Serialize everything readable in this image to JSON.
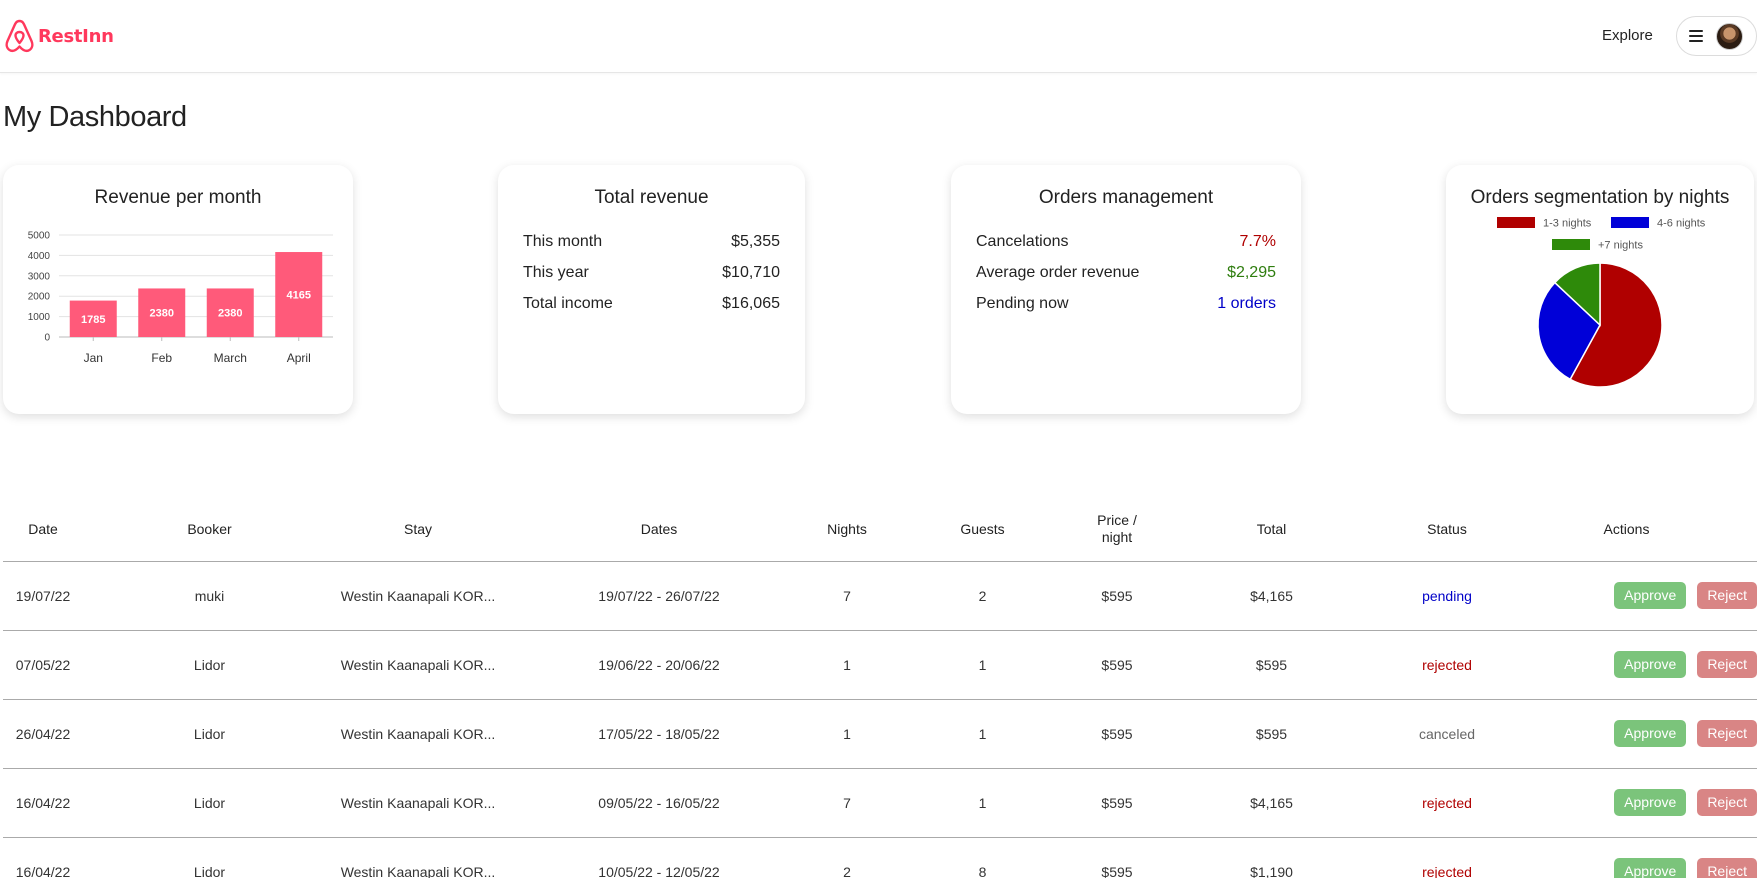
{
  "header": {
    "brand": "RestInn",
    "explore_label": "Explore",
    "icons": {
      "logo": "logo-icon",
      "menu": "menu-icon",
      "avatar": "avatar"
    }
  },
  "page": {
    "title": "My Dashboard"
  },
  "cards": {
    "revenue_chart": {
      "title": "Revenue per month"
    },
    "total_revenue": {
      "title": "Total revenue",
      "rows": [
        {
          "label": "This month",
          "value": "$5,355"
        },
        {
          "label": "This year",
          "value": "$10,710"
        },
        {
          "label": "Total income",
          "value": "$16,065"
        }
      ]
    },
    "orders_management": {
      "title": "Orders management",
      "rows": [
        {
          "label": "Cancelations",
          "value": "7.7%",
          "color": "#b00000"
        },
        {
          "label": "Average order revenue",
          "value": "$2,295",
          "color": "#2e7d0e"
        },
        {
          "label": "Pending now",
          "value": "1 orders",
          "color": "#0000c8"
        }
      ]
    },
    "segmentation": {
      "title": "Orders segmentation by nights"
    }
  },
  "chart_data": [
    {
      "type": "bar",
      "title": "Revenue per month",
      "categories": [
        "Jan",
        "Feb",
        "March",
        "April"
      ],
      "values": [
        1785,
        2380,
        2380,
        4165
      ],
      "data_labels": [
        "1785",
        "2380",
        "2380",
        "4165"
      ],
      "yticks": [
        "0",
        "1000",
        "2000",
        "3000",
        "4000",
        "5000"
      ],
      "ylim": [
        0,
        5000
      ],
      "grid": true,
      "bar_color": "#ff5a7a"
    },
    {
      "type": "pie",
      "title": "Orders segmentation by nights",
      "legend_position": "top",
      "labels": [
        "1-3 nights",
        "4-6 nights",
        "+7 nights"
      ],
      "values": [
        58,
        29,
        13
      ],
      "colors": [
        "#b00000",
        "#0000d8",
        "#2e8a0a"
      ]
    }
  ],
  "table": {
    "headers": [
      "Date",
      "Booker",
      "Stay",
      "Dates",
      "Nights",
      "Guests",
      "Price /\nnight",
      "Total",
      "Status",
      "Actions"
    ],
    "approve_label": "Approve",
    "reject_label": "Reject",
    "rows": [
      {
        "date": "19/07/22",
        "booker": "muki",
        "stay": "Westin Kaanapali KOR...",
        "dates": "19/07/22 - 26/07/22",
        "nights": "7",
        "guests": "2",
        "price": "$595",
        "total": "$4,165",
        "status": "pending"
      },
      {
        "date": "07/05/22",
        "booker": "Lidor",
        "stay": "Westin Kaanapali KOR...",
        "dates": "19/06/22 - 20/06/22",
        "nights": "1",
        "guests": "1",
        "price": "$595",
        "total": "$595",
        "status": "rejected"
      },
      {
        "date": "26/04/22",
        "booker": "Lidor",
        "stay": "Westin Kaanapali KOR...",
        "dates": "17/05/22 - 18/05/22",
        "nights": "1",
        "guests": "1",
        "price": "$595",
        "total": "$595",
        "status": "canceled"
      },
      {
        "date": "16/04/22",
        "booker": "Lidor",
        "stay": "Westin Kaanapali KOR...",
        "dates": "09/05/22 - 16/05/22",
        "nights": "7",
        "guests": "1",
        "price": "$595",
        "total": "$4,165",
        "status": "rejected"
      },
      {
        "date": "16/04/22",
        "booker": "Lidor",
        "stay": "Westin Kaanapali KOR...",
        "dates": "10/05/22 - 12/05/22",
        "nights": "2",
        "guests": "8",
        "price": "$595",
        "total": "$1,190",
        "status": "rejected"
      }
    ]
  }
}
